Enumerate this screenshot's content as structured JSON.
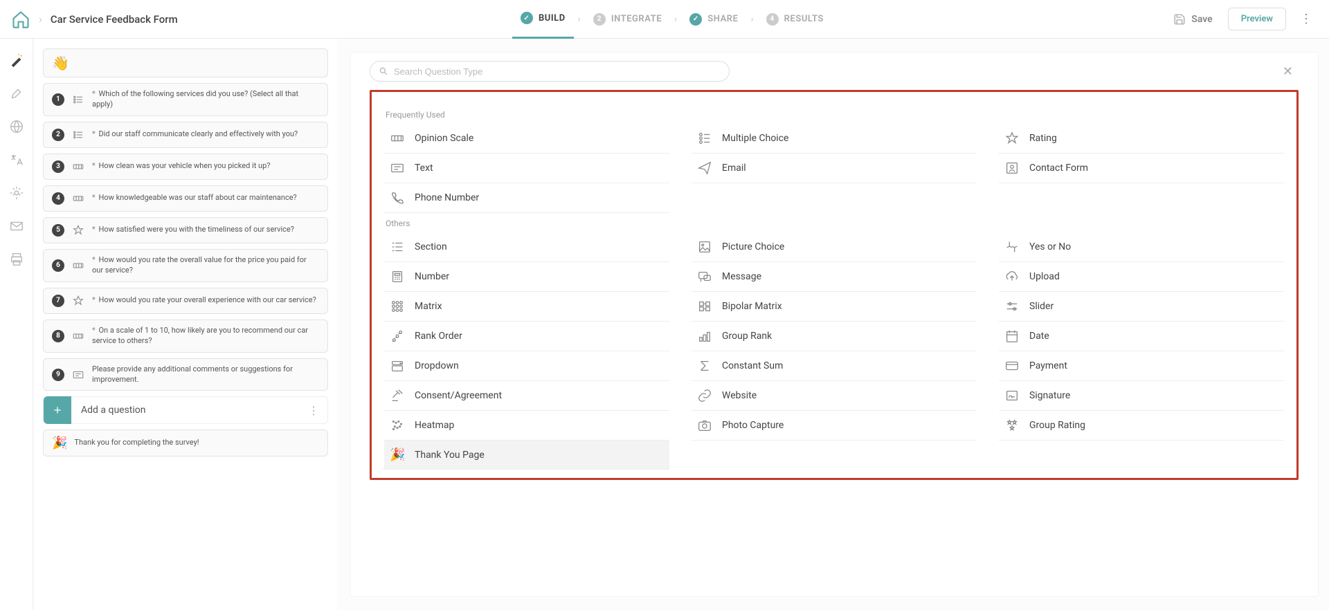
{
  "form_title": "Car Service Feedback Form",
  "nav": {
    "build": "BUILD",
    "integrate": "INTEGRATE",
    "share": "SHARE",
    "results": "RESULTS"
  },
  "actions": {
    "save": "Save",
    "preview": "Preview"
  },
  "questions": [
    {
      "num": 1,
      "req": true,
      "icon": "list",
      "text": "Which of the following services did you use? (Select all that apply)"
    },
    {
      "num": 2,
      "req": true,
      "icon": "list",
      "text": "Did our staff communicate clearly and effectively with you?"
    },
    {
      "num": 3,
      "req": true,
      "icon": "scale",
      "text": "How clean was your vehicle when you picked it up?"
    },
    {
      "num": 4,
      "req": true,
      "icon": "scale",
      "text": "How knowledgeable was our staff about car maintenance?"
    },
    {
      "num": 5,
      "req": true,
      "icon": "star",
      "text": "How satisfied were you with the timeliness of our service?"
    },
    {
      "num": 6,
      "req": true,
      "icon": "scale",
      "text": "How would you rate the overall value for the price you paid for our service?"
    },
    {
      "num": 7,
      "req": true,
      "icon": "star",
      "text": "How would you rate your overall experience with our car service?"
    },
    {
      "num": 8,
      "req": true,
      "icon": "scale",
      "text": "On a scale of 1 to 10, how likely are you to recommend our car service to others?"
    },
    {
      "num": 9,
      "req": false,
      "icon": "text",
      "text": "Please provide any additional comments or suggestions for improvement."
    }
  ],
  "add_question": "Add a question",
  "thanks_text": "Thank you for completing the survey!",
  "search_placeholder": "Search Question Type",
  "section_freq": "Frequently Used",
  "section_others": "Others",
  "types_freq": {
    "opinion_scale": "Opinion Scale",
    "multiple_choice": "Multiple Choice",
    "rating": "Rating",
    "text": "Text",
    "email": "Email",
    "contact_form": "Contact Form",
    "phone_number": "Phone Number"
  },
  "types_other": {
    "section": "Section",
    "picture_choice": "Picture Choice",
    "yes_or_no": "Yes or No",
    "number": "Number",
    "message": "Message",
    "upload": "Upload",
    "matrix": "Matrix",
    "bipolar_matrix": "Bipolar Matrix",
    "slider": "Slider",
    "rank_order": "Rank Order",
    "group_rank": "Group Rank",
    "date": "Date",
    "dropdown": "Dropdown",
    "constant_sum": "Constant Sum",
    "payment": "Payment",
    "consent": "Consent/Agreement",
    "website": "Website",
    "signature": "Signature",
    "heatmap": "Heatmap",
    "photo_capture": "Photo Capture",
    "group_rating": "Group Rating",
    "thank_you_page": "Thank You Page"
  }
}
